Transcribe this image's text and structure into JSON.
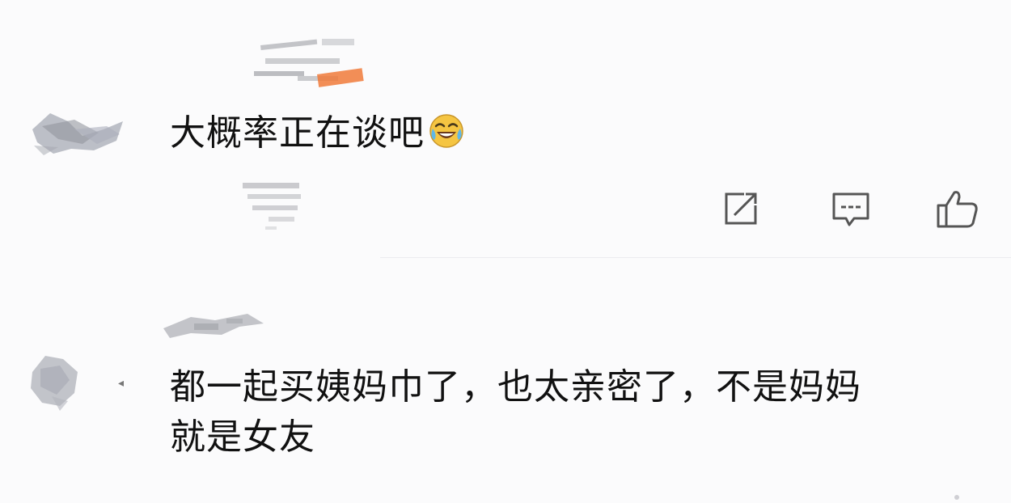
{
  "comments": [
    {
      "text_lines": [
        "大概率正在谈吧"
      ],
      "emoji": "laugh-cry-icon",
      "actions": [
        {
          "icon": "share-icon"
        },
        {
          "icon": "comment-icon"
        },
        {
          "icon": "thumbs-up-icon"
        }
      ]
    },
    {
      "text_lines": [
        "都一起买姨妈巾了，也太亲密了，不是妈妈",
        "就是女友"
      ]
    }
  ],
  "colors": {
    "background": "#fbfbfc",
    "text": "#111111",
    "icon_stroke": "#555555",
    "emoji_face": "#f5c542"
  }
}
